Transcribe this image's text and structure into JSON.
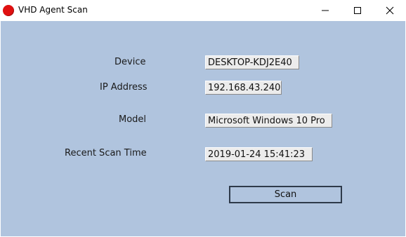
{
  "window": {
    "title": "VHD Agent Scan",
    "icon": "red-circle-icon",
    "controls": {
      "minimize": "minimize-icon",
      "maximize": "maximize-icon",
      "close": "close-icon"
    }
  },
  "form": {
    "device_label": "Device",
    "device_value": "DESKTOP-KDJ2E40",
    "ip_label": "IP Address",
    "ip_value": "192.168.43.240",
    "model_label": "Model",
    "model_value": "Microsoft Windows 10 Pro",
    "scan_time_label": "Recent Scan Time",
    "scan_time_value": "2019-01-24 15:41:23"
  },
  "actions": {
    "scan_label": "Scan"
  },
  "colors": {
    "client_background": "#b0c4de",
    "icon_red": "#e01010",
    "button_border": "#2e3a4a"
  }
}
